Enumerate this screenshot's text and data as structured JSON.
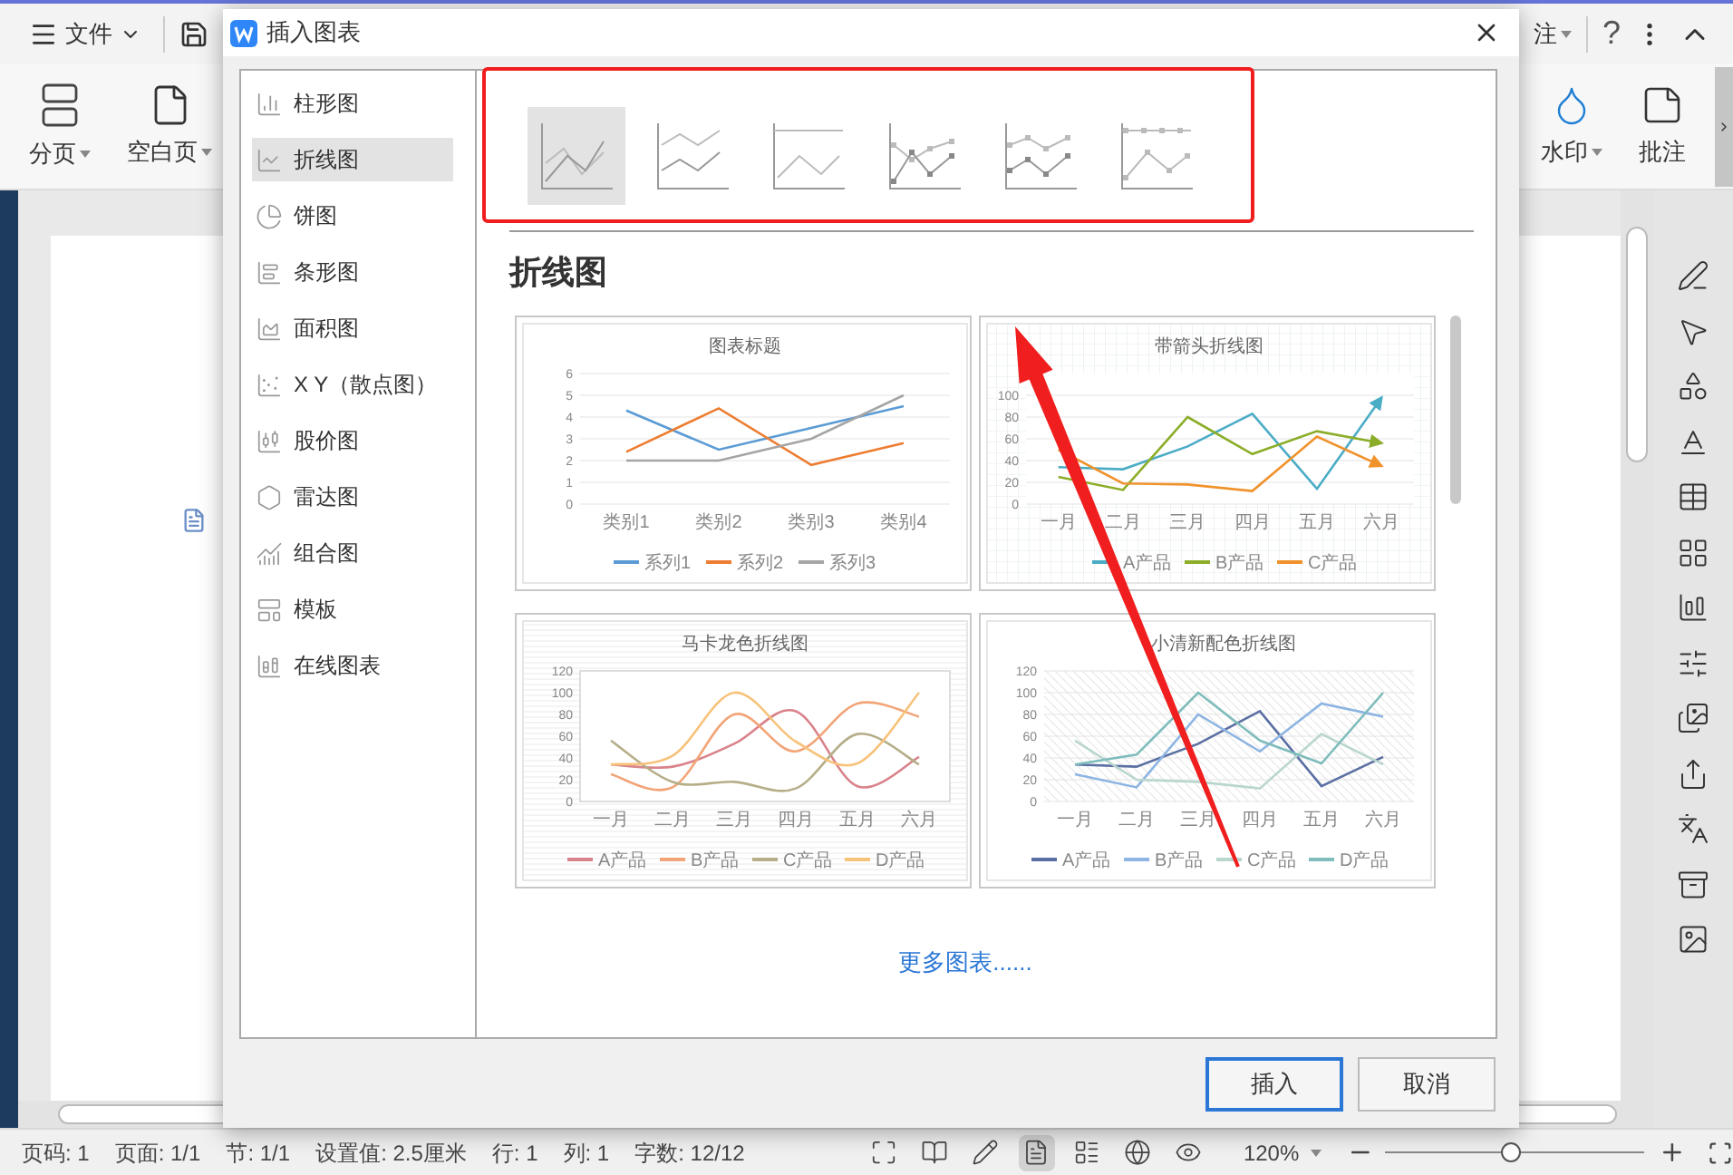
{
  "top_bar": {
    "file_menu": "文件",
    "partial_label": "注",
    "help": "?"
  },
  "ribbon": {
    "left": [
      {
        "label": "分页",
        "dropdown": true
      },
      {
        "label": "空白页",
        "dropdown": true
      }
    ],
    "right": [
      {
        "label": "水印",
        "dropdown": true
      },
      {
        "label": "批注",
        "dropdown": false
      }
    ]
  },
  "dialog": {
    "title": "插入图表",
    "categories": [
      {
        "label": "柱形图",
        "selected": false
      },
      {
        "label": "折线图",
        "selected": true
      },
      {
        "label": "饼图",
        "selected": false
      },
      {
        "label": "条形图",
        "selected": false
      },
      {
        "label": "面积图",
        "selected": false
      },
      {
        "label": "X Y（散点图）",
        "selected": false
      },
      {
        "label": "股价图",
        "selected": false
      },
      {
        "label": "雷达图",
        "selected": false
      },
      {
        "label": "组合图",
        "selected": false
      },
      {
        "label": "模板",
        "selected": false
      },
      {
        "label": "在线图表",
        "selected": false
      }
    ],
    "subtypes": [
      {
        "kind": "plain",
        "selected": true
      },
      {
        "kind": "stacked",
        "selected": false
      },
      {
        "kind": "percent",
        "selected": false
      },
      {
        "kind": "markers",
        "selected": false
      },
      {
        "kind": "stacked_markers",
        "selected": false
      },
      {
        "kind": "percent_markers",
        "selected": false
      }
    ],
    "section_title": "折线图",
    "previews": [
      {
        "kind": "plain",
        "chart_data": {
          "type": "line",
          "grid": true,
          "legend": true,
          "title": "图表标题",
          "categories": [
            "类别1",
            "类别2",
            "类别3",
            "类别4"
          ],
          "ylim": [
            0,
            6
          ],
          "yticks": [
            0,
            1,
            2,
            3,
            4,
            5,
            6
          ],
          "series": [
            {
              "name": "系列1",
              "color": "#5b9bd5",
              "values": [
                4.3,
                2.5,
                3.5,
                4.5
              ]
            },
            {
              "name": "系列2",
              "color": "#ed7d31",
              "values": [
                2.4,
                4.4,
                1.8,
                2.8
              ]
            },
            {
              "name": "系列3",
              "color": "#a5a5a5",
              "values": [
                2,
                2,
                3,
                5
              ]
            }
          ]
        }
      },
      {
        "kind": "arrow",
        "chart_data": {
          "type": "line",
          "grid": true,
          "legend": true,
          "title": "带箭头折线图",
          "categories": [
            "一月",
            "二月",
            "三月",
            "四月",
            "五月",
            "六月"
          ],
          "ylim": [
            0,
            120
          ],
          "yticks": [
            0,
            20,
            40,
            60,
            80,
            100
          ],
          "series": [
            {
              "name": "A产品",
              "color": "#4bacc6",
              "values": [
                34,
                32,
                53,
                83,
                14,
                98
              ]
            },
            {
              "name": "B产品",
              "color": "#8cad29",
              "values": [
                25,
                13,
                80,
                46,
                67,
                56
              ]
            },
            {
              "name": "C产品",
              "color": "#f0922b",
              "values": [
                50,
                19,
                18,
                12,
                62,
                35
              ]
            }
          ]
        }
      },
      {
        "kind": "smooth",
        "chart_data": {
          "type": "line",
          "grid": true,
          "legend": true,
          "title": "马卡龙色折线图",
          "categories": [
            "一月",
            "二月",
            "三月",
            "四月",
            "五月",
            "六月"
          ],
          "ylim": [
            0,
            120
          ],
          "yticks": [
            0,
            20,
            40,
            60,
            80,
            100,
            120
          ],
          "series": [
            {
              "name": "A产品",
              "color": "#d9828a",
              "values": [
                34,
                32,
                53,
                83,
                14,
                41
              ]
            },
            {
              "name": "B产品",
              "color": "#f2a477",
              "values": [
                25,
                13,
                80,
                46,
                90,
                78
              ]
            },
            {
              "name": "C产品",
              "color": "#b5ae88",
              "values": [
                56,
                18,
                18,
                12,
                62,
                34
              ]
            },
            {
              "name": "D产品",
              "color": "#f7c27a",
              "values": [
                34,
                42,
                100,
                55,
                35,
                100
              ]
            }
          ]
        }
      },
      {
        "kind": "hatched",
        "chart_data": {
          "type": "line",
          "grid": true,
          "legend": true,
          "title": "小清新配色折线图",
          "categories": [
            "一月",
            "二月",
            "三月",
            "四月",
            "五月",
            "六月"
          ],
          "ylim": [
            0,
            120
          ],
          "yticks": [
            0,
            20,
            40,
            60,
            80,
            100,
            120
          ],
          "series": [
            {
              "name": "A产品",
              "color": "#5a6fa3",
              "values": [
                34,
                32,
                53,
                83,
                14,
                41
              ]
            },
            {
              "name": "B产品",
              "color": "#8db4e2",
              "values": [
                25,
                13,
                80,
                46,
                90,
                78
              ]
            },
            {
              "name": "C产品",
              "color": "#b9d6cf",
              "values": [
                56,
                20,
                18,
                12,
                62,
                34
              ]
            },
            {
              "name": "D产品",
              "color": "#7fbcbc",
              "values": [
                34,
                43,
                100,
                56,
                35,
                100
              ]
            }
          ]
        }
      }
    ],
    "more_link": "更多图表......",
    "buttons": [
      {
        "label": "插入",
        "kind": "primary"
      },
      {
        "label": "取消",
        "kind": "secondary"
      }
    ]
  },
  "status_bar": {
    "fields": [
      "页码: 1",
      "页面: 1/1",
      "节: 1/1",
      "设置值: 2.5厘米",
      "行: 1",
      "列: 1",
      "字数: 12/12"
    ],
    "view_modes": [
      {
        "selected": false
      },
      {
        "selected": false
      },
      {
        "selected": false
      },
      {
        "selected": true
      },
      {
        "selected": false
      },
      {
        "selected": false
      },
      {
        "selected": false
      }
    ],
    "zoom": "120%",
    "zoom_slider": {
      "level": 0.48
    }
  }
}
